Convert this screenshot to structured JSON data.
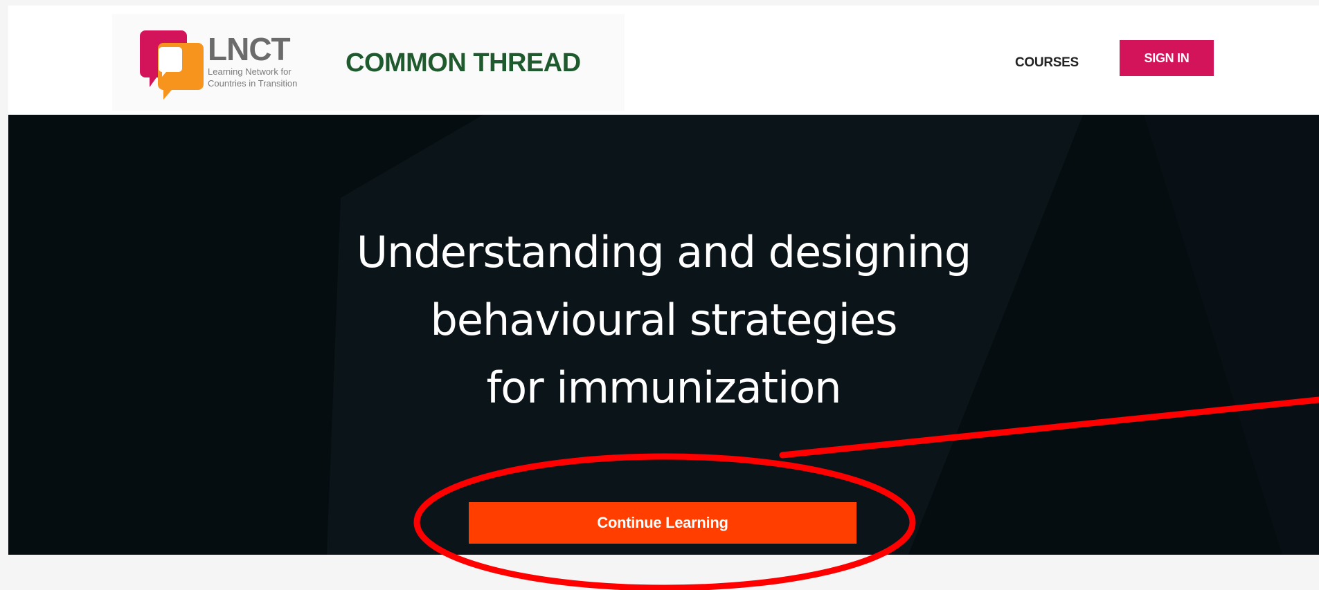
{
  "header": {
    "logo": {
      "acronym": "LNCT",
      "subtitle_line1": "Learning Network for",
      "subtitle_line2": "Countries in Transition",
      "colors": {
        "magenta": "#d4145a",
        "orange": "#f7941d"
      }
    },
    "site_title": "COMMON THREAD",
    "site_title_color": "#1f5a2e",
    "nav": {
      "courses_label": "COURSES",
      "signin_label": "SIGN IN",
      "signin_color": "#d4145a"
    }
  },
  "hero": {
    "title_line1": "Understanding and designing",
    "title_line2": "behavioural strategies",
    "title_line3": "for immunization",
    "cta_label": "Continue Learning",
    "cta_color": "#ff3e00",
    "background_color": "#060d11"
  },
  "annotation": {
    "shape": "ellipse-with-arrow",
    "color": "#ff0000"
  }
}
